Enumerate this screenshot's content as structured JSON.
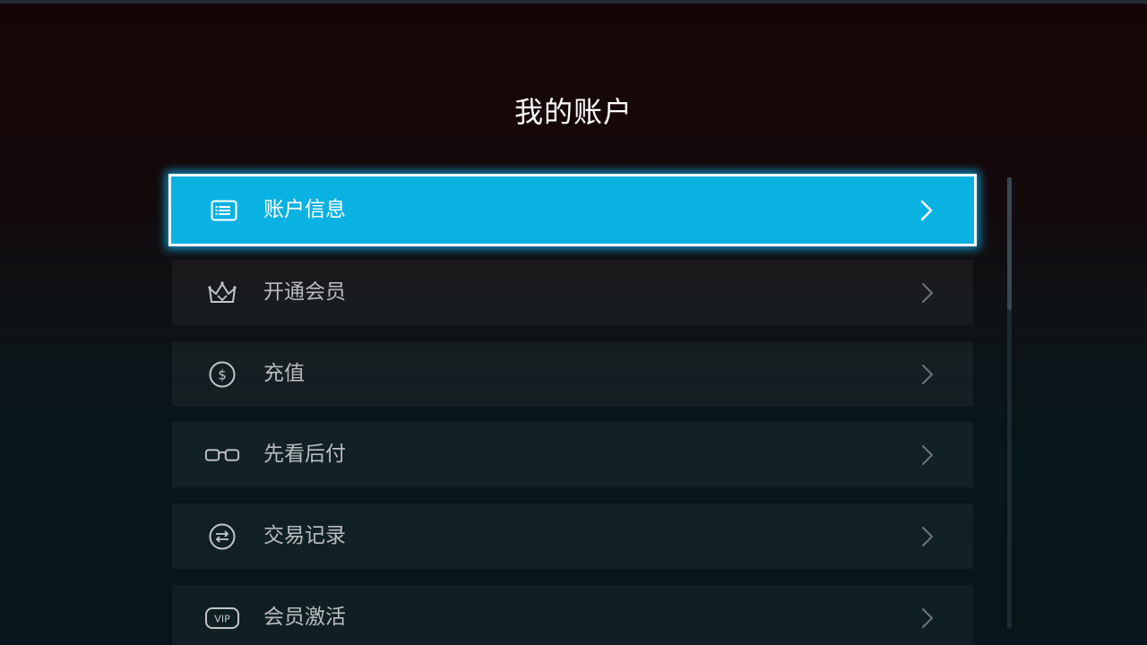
{
  "page": {
    "title": "我的账户"
  },
  "menu": {
    "items": [
      {
        "label": "账户信息",
        "icon": "id-card-icon",
        "selected": true
      },
      {
        "label": "开通会员",
        "icon": "crown-icon",
        "selected": false
      },
      {
        "label": "充值",
        "icon": "dollar-coin-icon",
        "selected": false
      },
      {
        "label": "先看后付",
        "icon": "glasses-icon",
        "selected": false
      },
      {
        "label": "交易记录",
        "icon": "exchange-icon",
        "selected": false
      },
      {
        "label": "会员激活",
        "icon": "vip-badge-icon",
        "selected": false
      }
    ]
  },
  "colors": {
    "accent": "#0ab2e2",
    "selected_border": "#ffffff",
    "label_text": "#b9bcbe"
  }
}
